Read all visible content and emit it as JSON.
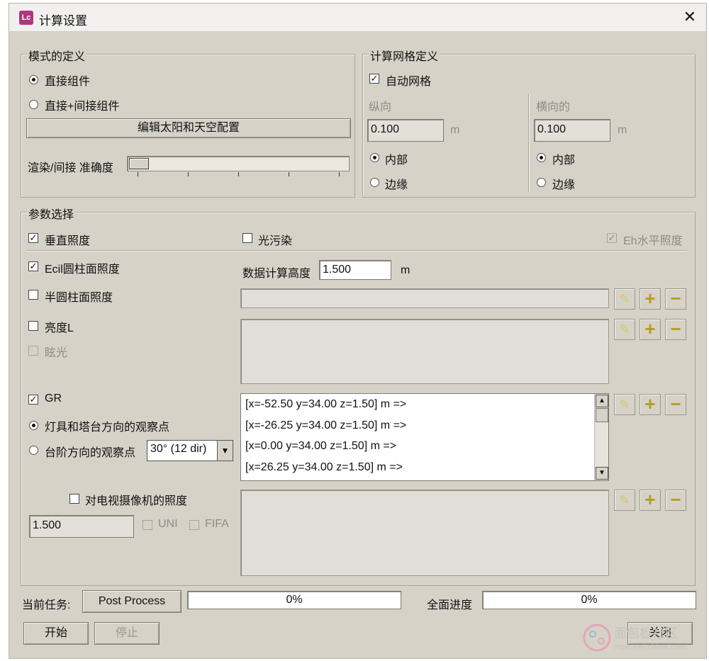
{
  "window": {
    "logo": "Lc",
    "title": "计算设置",
    "close": "✕"
  },
  "mode_group": {
    "legend": "模式的定义",
    "direct": "直接组件",
    "direct_indirect": "直接+间接组件",
    "edit_sky": "编辑太阳和天空配置",
    "render_label": "渲染/间接 准确度"
  },
  "grid_group": {
    "legend": "计算网格定义",
    "auto_grid": "自动网格",
    "longitudinal": "纵向",
    "transverse": "横向的",
    "long_value": "0.100",
    "trans_value": "0.100",
    "unit": "m",
    "inner": "内部",
    "edge": "边缘"
  },
  "params": {
    "legend": "参数选择",
    "vertical": "垂直照度",
    "light_pollution": "光污染",
    "eh": "Eh水平照度",
    "ecil": "Ecil圆柱面照度",
    "calc_height_label": "数据计算高度",
    "calc_height": "1.500",
    "unit": "m",
    "semi_cyl": "半圆柱面照度",
    "luminance": "亮度L",
    "glare": "眩光",
    "gr": "GR",
    "gr_opt1": "灯具和塔台方向的观察点",
    "gr_opt2": "台阶方向的观察点",
    "gr_combo": "30° (12 dir)",
    "gr_list": [
      "[x=-52.50 y=34.00 z=1.50] m =>",
      "[x=-26.25 y=34.00 z=1.50] m =>",
      "[x=0.00 y=34.00 z=1.50] m =>",
      "[x=26.25 y=34.00 z=1.50] m =>"
    ],
    "tv_label": "对电视摄像机的照度",
    "tv_value": "1.500",
    "uni": "UNI",
    "fifa": "FIFA"
  },
  "footer": {
    "task_label": "当前任务:",
    "task_value": "Post Process",
    "task_progress": "0%",
    "overall_label": "全面进度",
    "overall_progress": "0%",
    "start": "开始",
    "stop": "停止",
    "close": "关闭"
  },
  "watermark": {
    "line1": "面包板社区",
    "line2": "mbb.eet-china.com"
  }
}
